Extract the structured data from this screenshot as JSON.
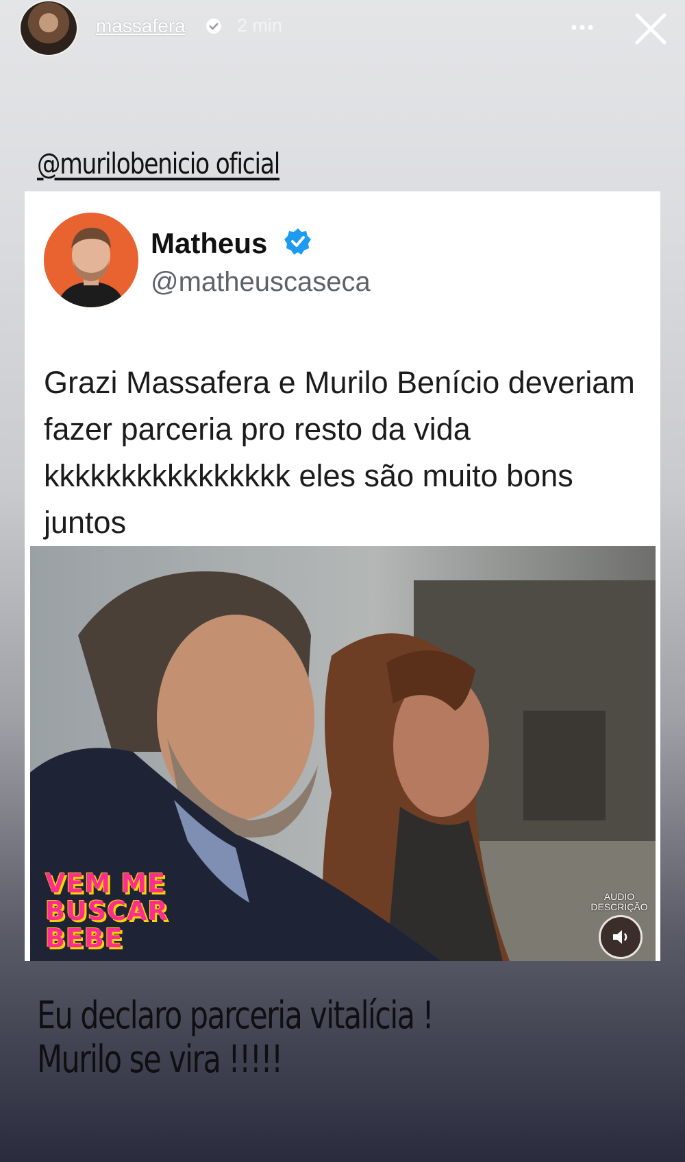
{
  "story": {
    "username": "massafera",
    "time": "2 min"
  },
  "mention": "@murilobenicio oficial",
  "tweet": {
    "name": "Matheus",
    "handle": "@matheuscaseca",
    "text": "Grazi Massafera e Murilo Benício deveriam fazer parceria pro resto da vida kkkkkkkkkkkkkkkk eles são muito bons juntos",
    "media": {
      "logo_text": "VEM ME BUSCAR BEBE",
      "audio_label": "AUDIO DESCRIÇÃO"
    }
  },
  "caption": "Eu declaro parceria vitalícia !\nMurilo se vira !!!!!",
  "colors": {
    "verified_blue": "#1d9bf0",
    "avatar_orange": "#e96331",
    "logo_pink": "#ff2d8f",
    "logo_yellow": "#f6d400"
  }
}
